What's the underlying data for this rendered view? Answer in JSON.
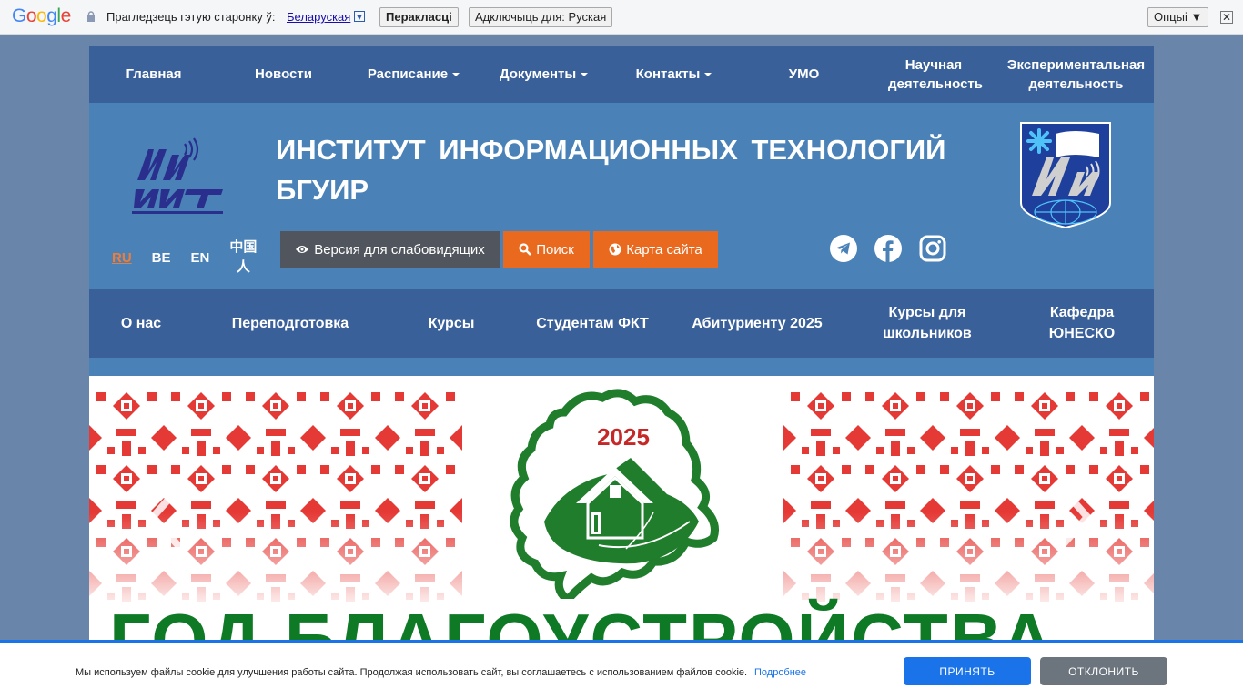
{
  "translate_bar": {
    "logo": "Google",
    "prompt": "Прагледзець гэтую старонку ў:",
    "language": "Беларуская",
    "translate_button": "Перакласці",
    "disable_button": "Адключыць для: Руская",
    "options_button": "Опцыі ▼",
    "close": "✕"
  },
  "top_nav": [
    {
      "label": "Главная"
    },
    {
      "label": "Новости"
    },
    {
      "label": "Расписание",
      "dropdown": true
    },
    {
      "label": "Документы",
      "dropdown": true
    },
    {
      "label": "Контакты",
      "dropdown": true
    },
    {
      "label": "УМО"
    },
    {
      "label": "Научная деятельность"
    },
    {
      "label": "Экспериментальная деятельность"
    }
  ],
  "header": {
    "title": "ИНСТИТУТ ИНФОРМАЦИОННЫХ ТЕХНОЛОГИЙ БГУИР",
    "languages": [
      "RU",
      "BE",
      "EN",
      "中国人"
    ],
    "active_language": "RU",
    "low_vision_button": "Версия для слабовидящих",
    "search_button": "Поиск",
    "sitemap_button": "Карта сайта"
  },
  "sub_nav": [
    {
      "label": "О нас"
    },
    {
      "label": "Переподготовка"
    },
    {
      "label": "Курсы"
    },
    {
      "label": "Студентам ФКТ"
    },
    {
      "label": "Абитуриенту 2025"
    },
    {
      "label": "Курсы для школьников"
    },
    {
      "label": "Кафедра ЮНЕСКО"
    }
  ],
  "banner": {
    "year": "2025",
    "headline": "ГОД БЛАГОУСТРОЙСТВА"
  },
  "cookie": {
    "text": "Мы используем файлы cookie для улучшения работы сайта. Продолжая использовать сайт, вы соглашаетесь с использованием файлов cookie.",
    "more": "Подробнее",
    "accept": "ПРИНЯТЬ",
    "decline": "ОТКЛОНИТЬ"
  },
  "colors": {
    "nav": "#3a609a",
    "header": "#4a82b8",
    "accent_orange": "#e96a1f",
    "banner_green": "#0f7a26",
    "cookie_blue": "#1a73e8"
  }
}
